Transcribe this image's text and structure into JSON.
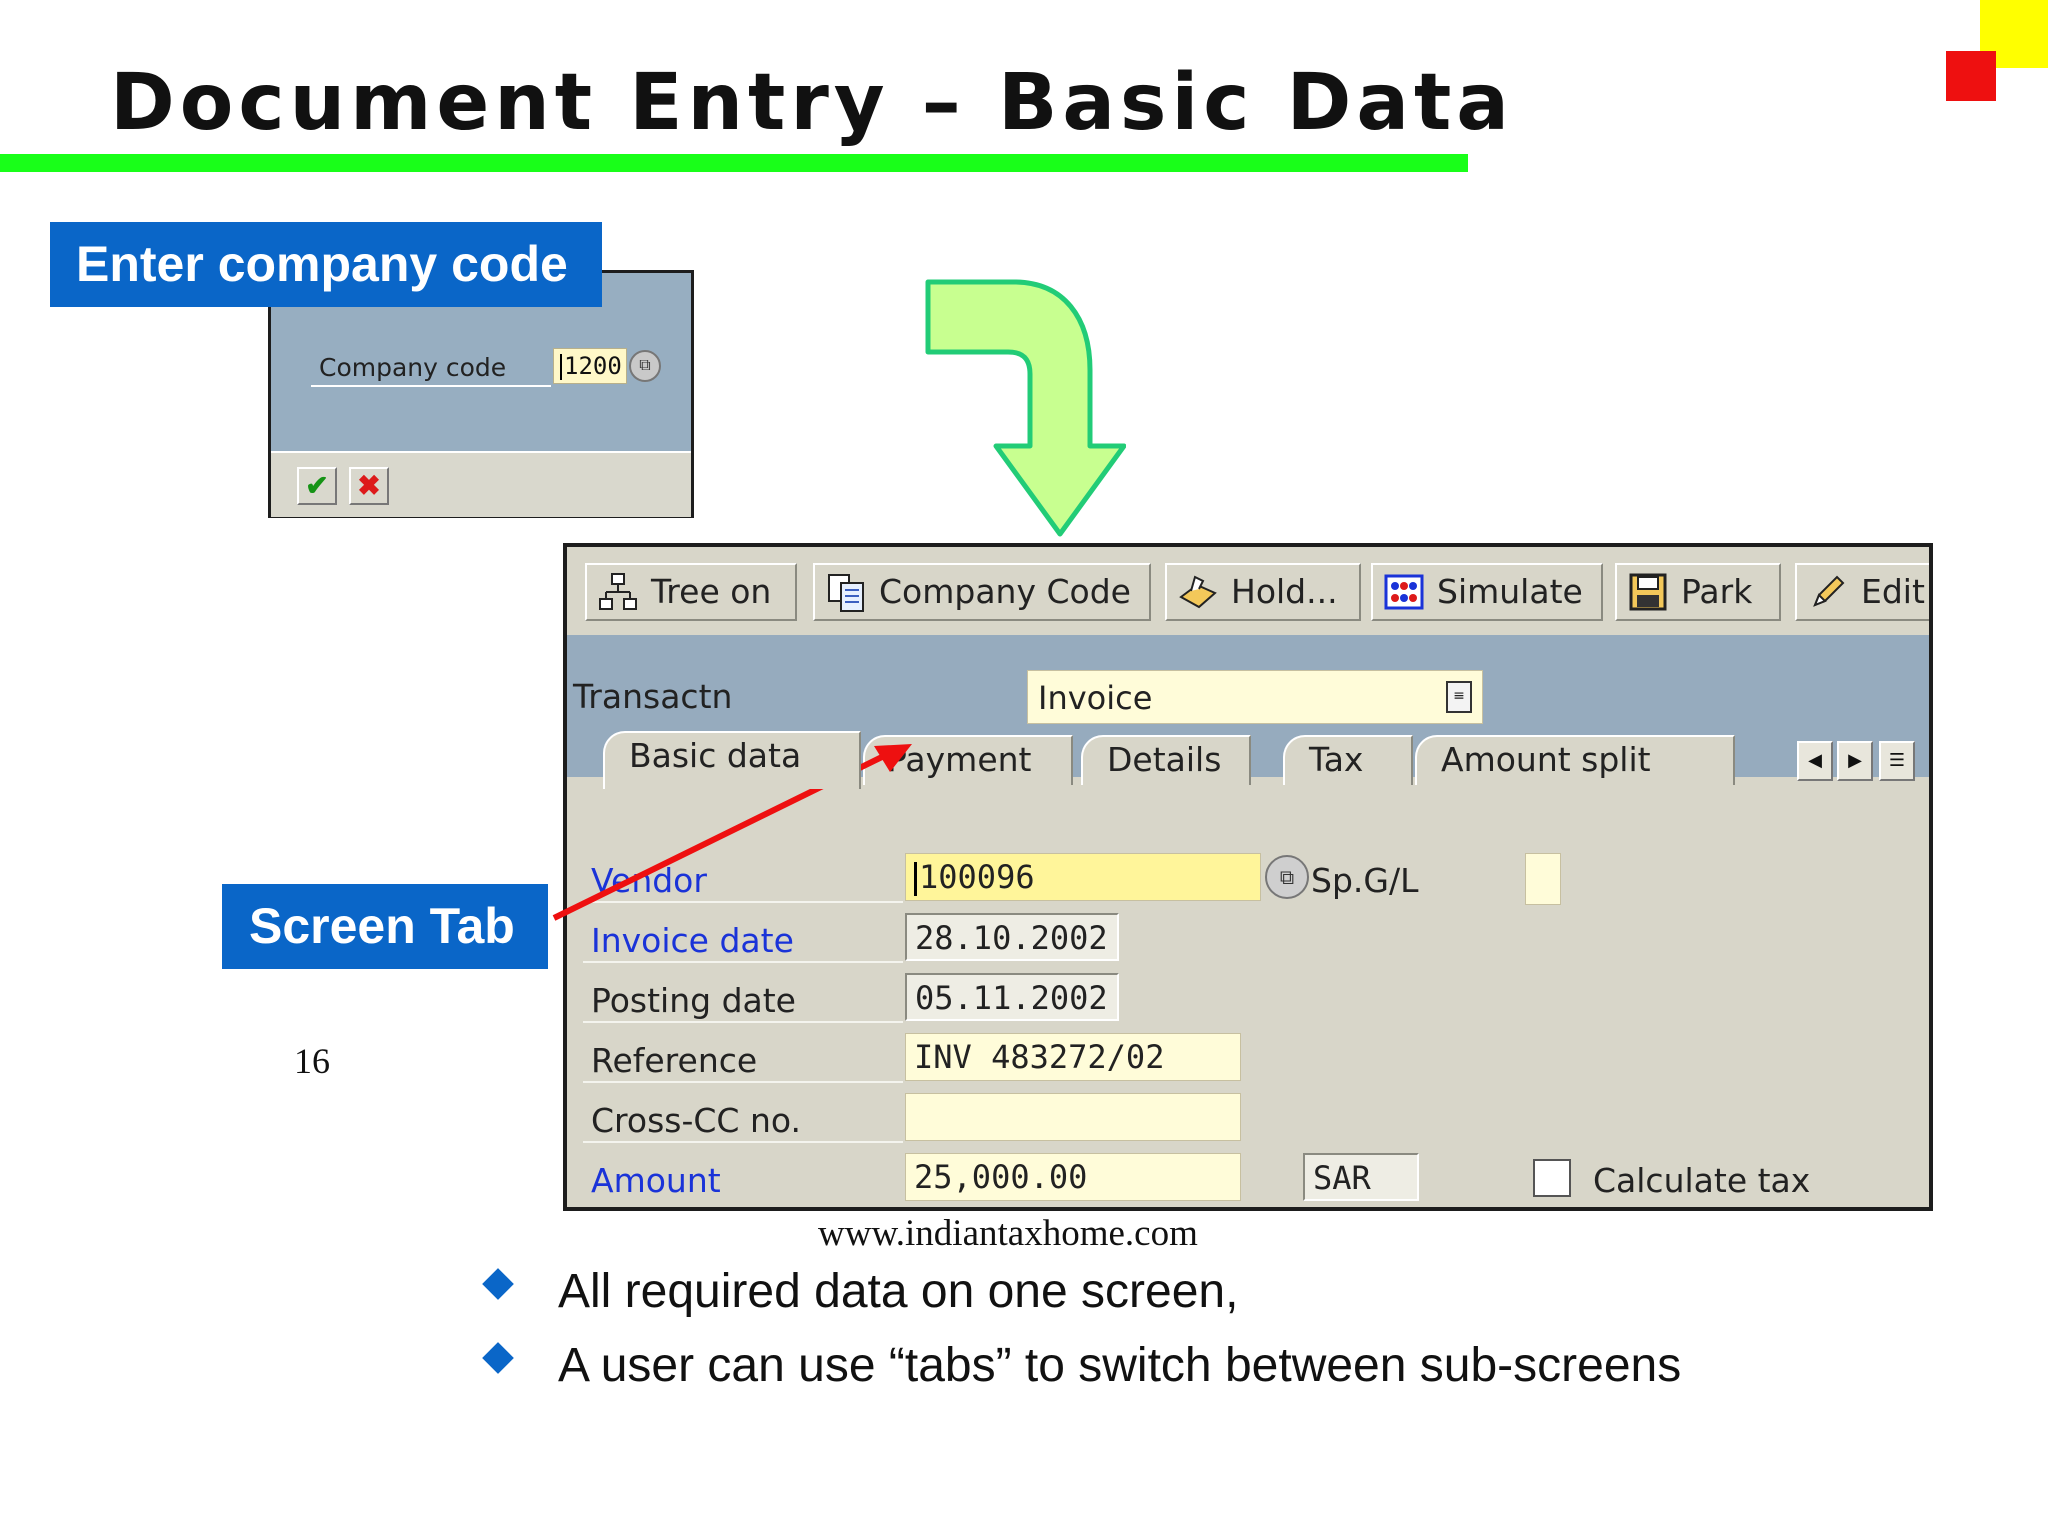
{
  "slide": {
    "title": "Document Entry – Basic Data",
    "page_number": "16",
    "website": "www.indiantaxhome.com",
    "bullets": [
      "All required data on one screen,",
      "A user can use “tabs” to switch between sub-screens"
    ]
  },
  "callouts": {
    "company_code": "Enter company code",
    "screen_tab": "Screen Tab"
  },
  "company_dialog": {
    "field_label": "Company code",
    "field_value": "1200"
  },
  "sap": {
    "toolbar": [
      {
        "label": "Tree on",
        "icon": "tree-icon"
      },
      {
        "label": "Company Code",
        "icon": "company-code-icon"
      },
      {
        "label": "Hold...",
        "icon": "hold-icon"
      },
      {
        "label": "Simulate",
        "icon": "simulate-icon"
      },
      {
        "label": "Park",
        "icon": "save-icon"
      },
      {
        "label": "Edit",
        "icon": "pencil-icon"
      }
    ],
    "transaction_label": "Transactn",
    "transaction_value": "Invoice",
    "tabs": [
      "Basic data",
      "Payment",
      "Details",
      "Tax",
      "Amount split"
    ],
    "active_tab": "Basic data",
    "form": {
      "vendor_label": "Vendor",
      "vendor_value": "100096",
      "spgl_label": "Sp.G/L",
      "invoice_date_label": "Invoice date",
      "invoice_date_value": "28.10.2002",
      "posting_date_label": "Posting date",
      "posting_date_value": "05.11.2002",
      "reference_label": "Reference",
      "reference_value": "INV 483272/02",
      "cross_cc_label": "Cross-CC no.",
      "cross_cc_value": "",
      "amount_label": "Amount",
      "amount_value": "25,000.00",
      "currency_value": "SAR",
      "calculate_tax_label": "Calculate tax"
    }
  },
  "colors": {
    "title_rule": "#19ff19",
    "callout_bg": "#0a66c8",
    "sap_header": "#96abbe",
    "sap_body": "#d8d6c9",
    "required_label": "#1a33d8",
    "arrow_green": "#c8ff90",
    "arrow_red": "#ee1010"
  }
}
